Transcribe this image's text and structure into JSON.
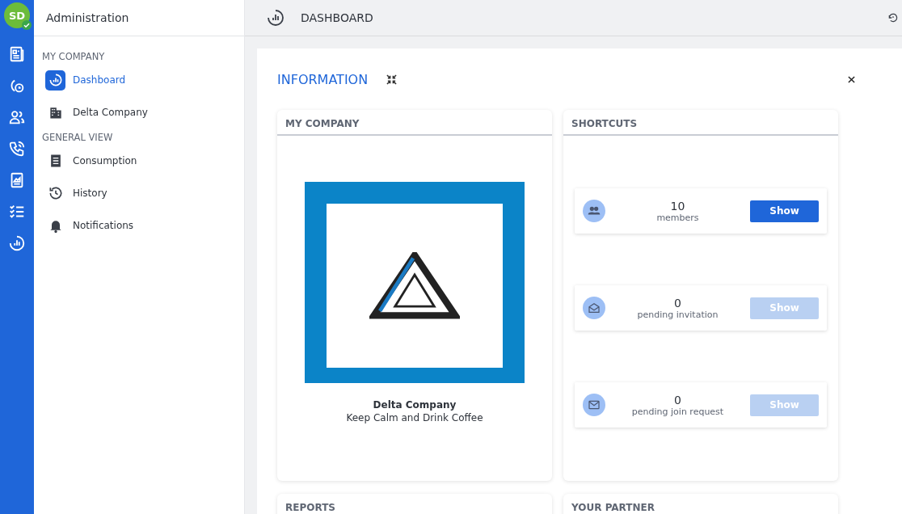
{
  "user": {
    "initials": "SD",
    "verified": true
  },
  "rail": [
    {
      "kind": "news"
    },
    {
      "kind": "phone-clock"
    },
    {
      "kind": "users"
    },
    {
      "kind": "phone"
    },
    {
      "kind": "report"
    },
    {
      "kind": "checklist"
    },
    {
      "kind": "dashboard"
    }
  ],
  "sidebar": {
    "title": "Administration",
    "sections": [
      {
        "heading": "MY COMPANY",
        "items": [
          {
            "label": "Dashboard",
            "kind": "dashboard",
            "selected": true
          },
          {
            "label": "Delta Company",
            "kind": "building",
            "selected": false
          }
        ]
      },
      {
        "heading": "GENERAL VIEW",
        "items": [
          {
            "label": "Consumption",
            "kind": "list",
            "selected": false
          },
          {
            "label": "History",
            "kind": "history",
            "selected": false
          },
          {
            "label": "Notifications",
            "kind": "bell",
            "selected": false
          }
        ]
      }
    ]
  },
  "header": {
    "title": "DASHBOARD"
  },
  "panel": {
    "title": "INFORMATION",
    "my_company": {
      "title": "MY COMPANY",
      "name": "Delta Company",
      "slogan": "Keep Calm and Drink Coffee"
    },
    "shortcuts": {
      "title": "SHORTCUTS",
      "items": [
        {
          "kind": "members",
          "count": "10",
          "label": "members",
          "button": "Show",
          "disabled": false
        },
        {
          "kind": "invitation",
          "count": "0",
          "label": "pending invitation",
          "button": "Show",
          "disabled": true
        },
        {
          "kind": "mail",
          "count": "0",
          "label": "pending join request",
          "button": "Show",
          "disabled": true
        }
      ]
    },
    "bottom_cards": [
      {
        "title": "REPORTS"
      },
      {
        "title": "YOUR PARTNER"
      }
    ]
  }
}
